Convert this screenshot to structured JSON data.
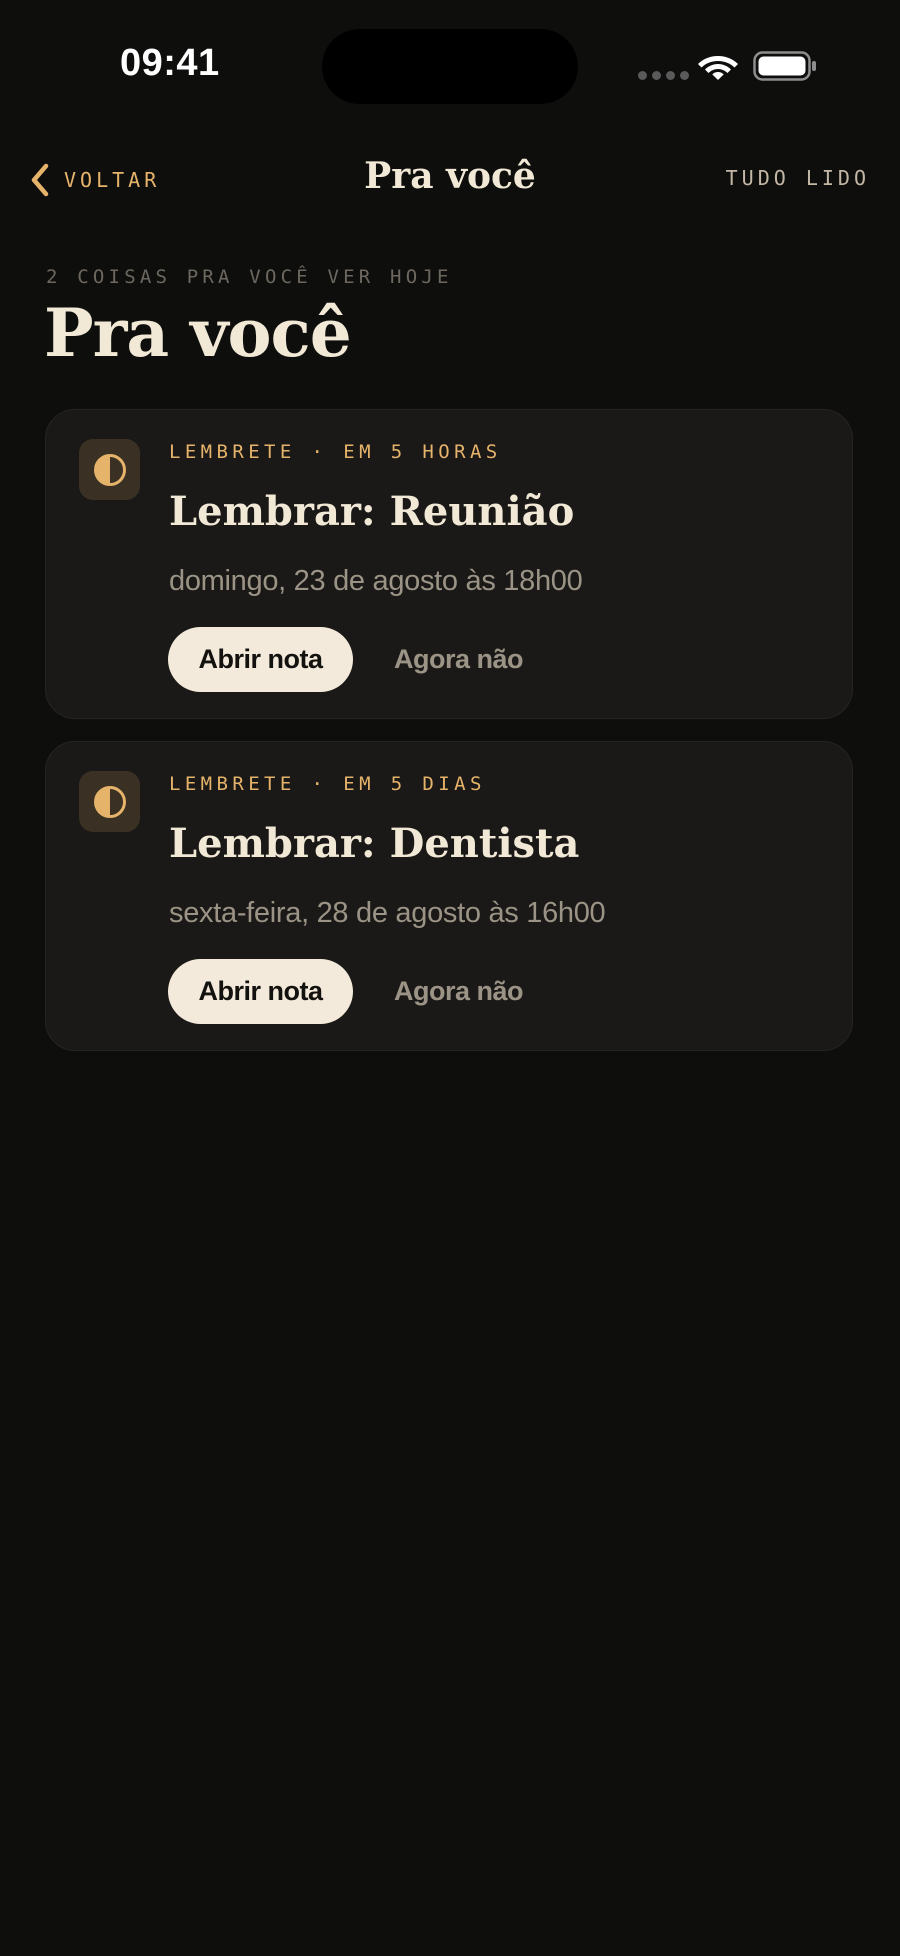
{
  "status_bar": {
    "time": "09:41"
  },
  "nav": {
    "back_label": "VOLTAR",
    "title": "Pra você",
    "mark_all_label": "TUDO LIDO"
  },
  "header": {
    "eyebrow": "2 COISAS PRA VOCÊ VER HOJE",
    "title": "Pra você"
  },
  "cards": [
    {
      "icon": "half-moon-icon",
      "kicker": "LEMBRETE · EM 5 HORAS",
      "title": "Lembrar: Reunião",
      "date": "domingo, 23 de agosto às 18h00",
      "primary_action": "Abrir nota",
      "secondary_action": "Agora não"
    },
    {
      "icon": "half-moon-icon",
      "kicker": "LEMBRETE · EM 5 DIAS",
      "title": "Lembrar: Dentista",
      "date": "sexta-feira, 28 de agosto às 16h00",
      "primary_action": "Abrir nota",
      "secondary_action": "Agora não"
    }
  ],
  "colors": {
    "background": "#0e0e0d",
    "card": "#1a1917",
    "accent": "#e6b36b",
    "text_primary": "#f1e8d6",
    "text_secondary": "#9b9385",
    "button_primary_bg": "#f3eadb"
  }
}
